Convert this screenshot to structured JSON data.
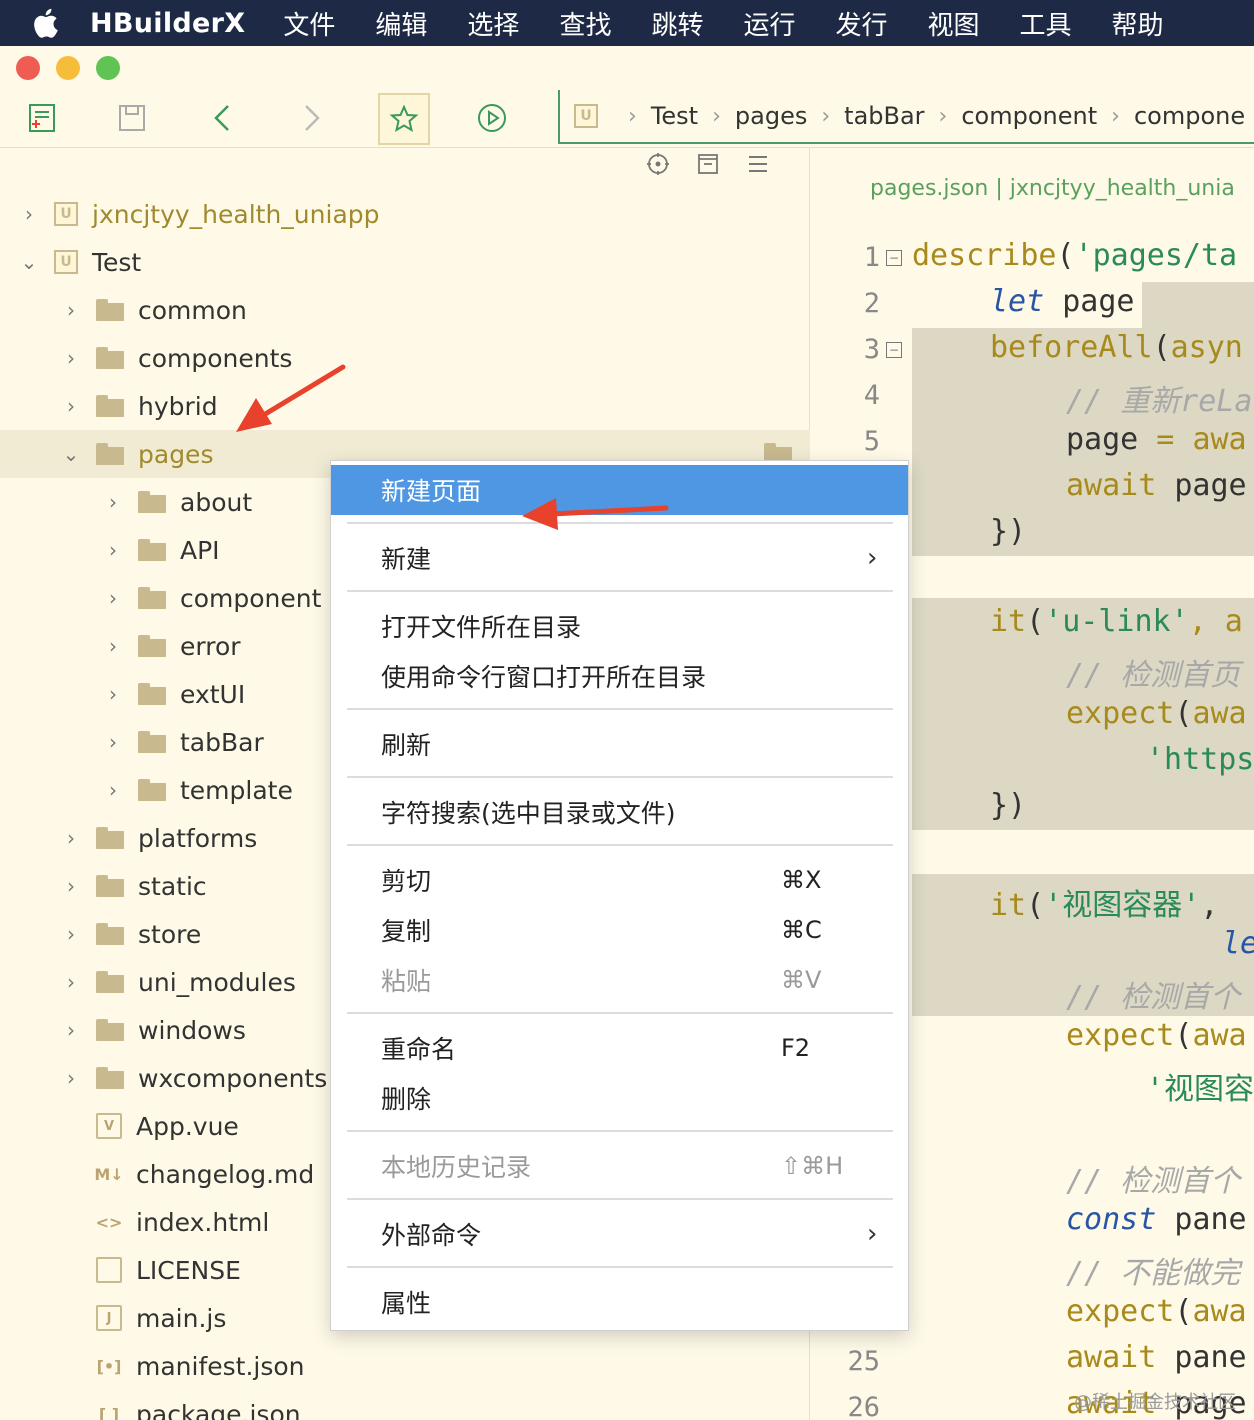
{
  "menubar": {
    "app_name": "HBuilderX",
    "items": [
      "文件",
      "编辑",
      "选择",
      "查找",
      "跳转",
      "运行",
      "发行",
      "视图",
      "工具",
      "帮助"
    ]
  },
  "breadcrumb": [
    "Test",
    "pages",
    "tabBar",
    "component",
    "compone"
  ],
  "tree": [
    {
      "label": "jxncjtyy_health_uniapp",
      "type": "project",
      "expanded": false
    },
    {
      "label": "Test",
      "type": "project",
      "expanded": true
    },
    {
      "label": "common",
      "type": "folder"
    },
    {
      "label": "components",
      "type": "folder"
    },
    {
      "label": "hybrid",
      "type": "folder"
    },
    {
      "label": "pages",
      "type": "folder-open"
    },
    {
      "label": "about",
      "type": "folder"
    },
    {
      "label": "API",
      "type": "folder"
    },
    {
      "label": "component",
      "type": "folder"
    },
    {
      "label": "error",
      "type": "folder"
    },
    {
      "label": "extUI",
      "type": "folder"
    },
    {
      "label": "tabBar",
      "type": "folder"
    },
    {
      "label": "template",
      "type": "folder"
    },
    {
      "label": "platforms",
      "type": "folder"
    },
    {
      "label": "static",
      "type": "folder"
    },
    {
      "label": "store",
      "type": "folder"
    },
    {
      "label": "uni_modules",
      "type": "folder"
    },
    {
      "label": "windows",
      "type": "folder"
    },
    {
      "label": "wxcomponents",
      "type": "folder"
    },
    {
      "label": "App.vue",
      "type": "file",
      "icon": "V"
    },
    {
      "label": "changelog.md",
      "type": "file",
      "icon": "M↓"
    },
    {
      "label": "index.html",
      "type": "file",
      "icon": "<>"
    },
    {
      "label": "LICENSE",
      "type": "file",
      "icon": ""
    },
    {
      "label": "main.js",
      "type": "file",
      "icon": "J"
    },
    {
      "label": "manifest.json",
      "type": "file",
      "icon": "[•]"
    },
    {
      "label": "package.json",
      "type": "file",
      "icon": "[ ]"
    }
  ],
  "editor": {
    "tab_title": "pages.json | jxncjtyy_health_unia",
    "line_numbers": [
      "1",
      "2",
      "3",
      "4",
      "5",
      "25",
      "26"
    ],
    "lines": {
      "l1_fn": "describe",
      "l1_rest": "(",
      "l1_str": "'pages/ta",
      "l2_kw": "let",
      "l2_rest": " page",
      "l3_fn": "beforeAll",
      "l3_rest": "(",
      "l3_fn2": "asyn",
      "l4_cm": "// 重新reLa",
      "l5_a": "page",
      "l5_b": " = ",
      "l5_c": "awa",
      "l6_a": "await",
      "l6_b": " page",
      "l7": "})",
      "l9_fn": "it",
      "l9_p": "(",
      "l9_str": "'u-link'",
      "l9_rest": ", a",
      "l10_cm": "// 检测首页",
      "l11_fn": "expect",
      "l11_p": "(",
      "l11_c": "awa",
      "l12_str": "'https",
      "l13": "})",
      "l15_fn": "it",
      "l15_p": "(",
      "l15_str": "'视图容器'",
      "l15_rest": ", ",
      "l16_kw": "le",
      "l17_cm": "// 检测首个",
      "l18_fn": "expect",
      "l18_p": "(",
      "l18_c": "awa",
      "l19_str": "'视图容",
      "l21_cm": "// 检测首个",
      "l22_kw": "const",
      "l22_rest": " pane",
      "l23_cm": "// 不能做完",
      "l24_fn": "expect",
      "l24_p": "(",
      "l24_c": "awa",
      "l25_a": "await",
      "l25_b": " pane",
      "l26_a": "await",
      "l26_b": " page"
    }
  },
  "context_menu": {
    "items": [
      {
        "label": "新建页面",
        "state": "active"
      },
      {
        "label": "新建",
        "submenu": true
      },
      {
        "label": "打开文件所在目录"
      },
      {
        "label": "使用命令行窗口打开所在目录"
      },
      {
        "label": "刷新"
      },
      {
        "label": "字符搜索(选中目录或文件)"
      },
      {
        "label": "剪切",
        "shortcut": "⌘X"
      },
      {
        "label": "复制",
        "shortcut": "⌘C"
      },
      {
        "label": "粘贴",
        "shortcut": "⌘V",
        "state": "disabled"
      },
      {
        "label": "重命名",
        "shortcut": "F2"
      },
      {
        "label": "删除"
      },
      {
        "label": "本地历史记录",
        "shortcut": "⇧⌘H",
        "state": "disabled"
      },
      {
        "label": "外部命令",
        "submenu": true
      },
      {
        "label": "属性"
      }
    ],
    "submenu_arrow": "›"
  },
  "watermark": "@稀土掘金技术社区",
  "colors": {
    "menubar_bg": "#1e2a45",
    "sidebar_bg": "#fffae8",
    "menu_highlight": "#4f97e3",
    "arrow_red": "#e8412c"
  }
}
